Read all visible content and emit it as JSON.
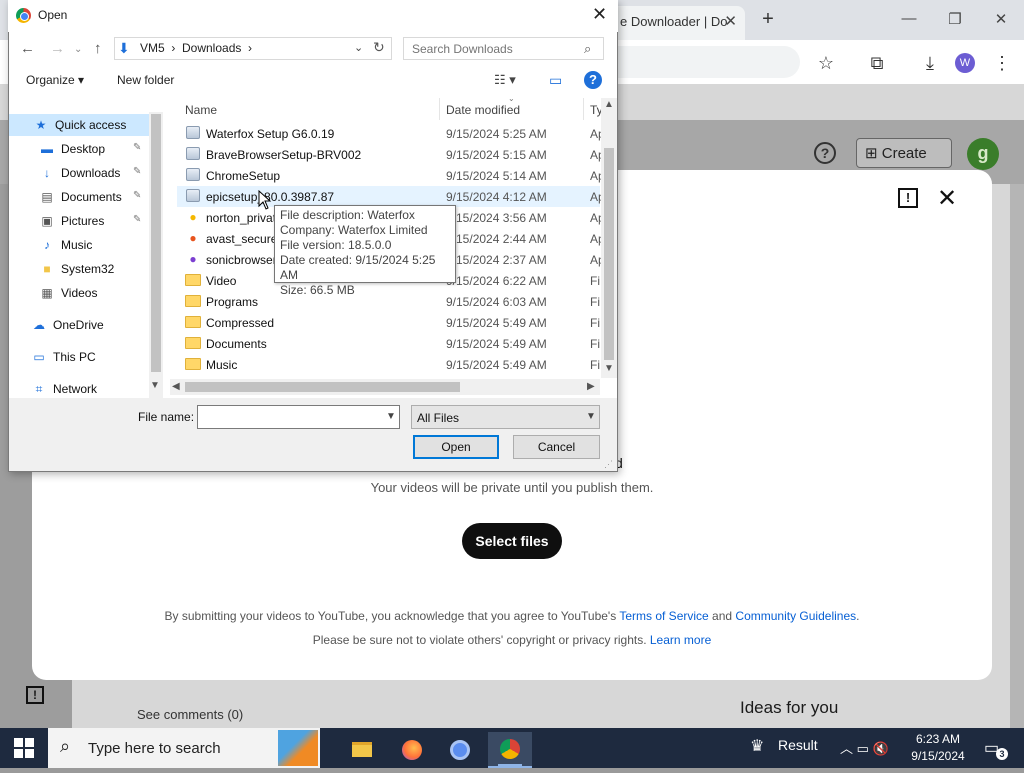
{
  "browser": {
    "tab_title": "e Downloader | Do",
    "new_tab_icon": "plus-icon",
    "toolbar_icons": [
      "star-icon",
      "extensions-icon",
      "download-icon",
      "menu-icon"
    ],
    "profile_initial": "W"
  },
  "studio": {
    "create_label": "Create",
    "user_initial": "g",
    "ideas_label": "Ideas for you",
    "see_comments": "See comments (0)"
  },
  "upload_modal": {
    "drag_suffix": "d",
    "private_note": "Your videos will be private until you publish them.",
    "select_files_label": "Select files",
    "legal_line1_prefix": "By submitting your videos to YouTube, you acknowledge that you agree to YouTube's ",
    "terms_link": "Terms of Service",
    "legal_and": " and ",
    "guidelines_link": "Community Guidelines",
    "legal_period": ".",
    "legal_line2_prefix": "Please be sure not to violate others' copyright or privacy rights. ",
    "learn_more_link": "Learn more"
  },
  "dialog": {
    "title": "Open",
    "address": "VM5  ›  Downloads  ›",
    "search_placeholder": "Search Downloads",
    "organize_label": "Organize ▾",
    "new_folder_label": "New folder",
    "nav": [
      {
        "label": "Quick access",
        "icon": "★",
        "pinned": false
      },
      {
        "label": "Desktop",
        "icon": "▬",
        "pinned": true
      },
      {
        "label": "Downloads",
        "icon": "↓",
        "pinned": true
      },
      {
        "label": "Documents",
        "icon": "▤",
        "pinned": true
      },
      {
        "label": "Pictures",
        "icon": "▣",
        "pinned": true
      },
      {
        "label": "Music",
        "icon": "♪",
        "pinned": false
      },
      {
        "label": "System32",
        "icon": "■",
        "pinned": false
      },
      {
        "label": "Videos",
        "icon": "▦",
        "pinned": false
      },
      {
        "label": "OneDrive",
        "icon": "☁",
        "pinned": false
      },
      {
        "label": "This PC",
        "icon": "▭",
        "pinned": false
      },
      {
        "label": "Network",
        "icon": "⌗",
        "pinned": false
      }
    ],
    "columns": {
      "name": "Name",
      "date": "Date modified",
      "type": "Ty"
    },
    "files": [
      {
        "name": "Waterfox Setup G6.0.19",
        "date": "9/15/2024 5:25 AM",
        "type": "Ap",
        "icon": "exe"
      },
      {
        "name": "BraveBrowserSetup-BRV002",
        "date": "9/15/2024 5:15 AM",
        "type": "Ap",
        "icon": "exe"
      },
      {
        "name": "ChromeSetup",
        "date": "9/15/2024 5:14 AM",
        "type": "Ap",
        "icon": "exe"
      },
      {
        "name": "epicsetup_80.0.3987.87",
        "date": "9/15/2024 4:12 AM",
        "type": "Ap",
        "icon": "exe"
      },
      {
        "name": "norton_privat",
        "date": "9/15/2024 3:56 AM",
        "type": "Ap",
        "icon": "norton"
      },
      {
        "name": "avast_secure_",
        "date": "9/15/2024 2:44 AM",
        "type": "Ap",
        "icon": "avast"
      },
      {
        "name": "sonicbrowser",
        "date": "9/15/2024 2:37 AM",
        "type": "Ap",
        "icon": "sonic"
      },
      {
        "name": "Video",
        "date": "9/15/2024 6:22 AM",
        "type": "Fi",
        "icon": "folder"
      },
      {
        "name": "Programs",
        "date": "9/15/2024 6:03 AM",
        "type": "Fi",
        "icon": "folder"
      },
      {
        "name": "Compressed",
        "date": "9/15/2024 5:49 AM",
        "type": "Fi",
        "icon": "folder"
      },
      {
        "name": "Documents",
        "date": "9/15/2024 5:49 AM",
        "type": "Fi",
        "icon": "folder"
      },
      {
        "name": "Music",
        "date": "9/15/2024 5:49 AM",
        "type": "Fi",
        "icon": "folder"
      }
    ],
    "tooltip": {
      "description": "File description: Waterfox",
      "company": "Company: Waterfox Limited",
      "version": "File version: 18.5.0.0",
      "created": "Date created: 9/15/2024 5:25 AM",
      "size": "Size: 66.5 MB"
    },
    "file_name_label": "File name:",
    "file_name_value": "",
    "filter_value": "All Files",
    "open_label": "Open",
    "cancel_label": "Cancel"
  },
  "taskbar": {
    "search_placeholder": "Type here to search",
    "result_label": "Result",
    "time": "6:23 AM",
    "date": "9/15/2024",
    "notification_count": "3"
  },
  "colors": {
    "accent": "#0078d7",
    "link": "#065fd4",
    "taskbar": "#1e2a3f",
    "select_button": "#0f0f0f"
  }
}
